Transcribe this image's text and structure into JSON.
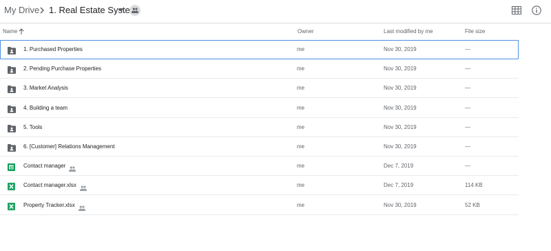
{
  "breadcrumb": {
    "root": "My Drive",
    "current": "1. Real Estate System"
  },
  "icons": {
    "breadcrumb_separator": "chevron-right-icon",
    "folder_dropdown": "caret-down-icon",
    "shared_folder": "people-icon",
    "grid_view": "grid-view-icon",
    "details": "info-icon",
    "sort": "arrow-up-icon"
  },
  "columns": {
    "name": "Name",
    "owner": "Owner",
    "last_modified": "Last modified by me",
    "file_size": "File size"
  },
  "colors": {
    "folder": "#5f6368",
    "sheets": "#0f9d58",
    "excel": "#21a366",
    "selection": "#4c8fe0"
  },
  "files": [
    {
      "name": "1. Purchased Properties",
      "type": "shared-folder",
      "shared": false,
      "owner": "me",
      "modified": "Nov 30, 2019",
      "size": "—",
      "selected": true
    },
    {
      "name": "2. Pending Purchase Properties",
      "type": "shared-folder",
      "shared": false,
      "owner": "me",
      "modified": "Nov 30, 2019",
      "size": "—",
      "selected": false
    },
    {
      "name": "3. Market Analysis",
      "type": "shared-folder",
      "shared": false,
      "owner": "me",
      "modified": "Nov 30, 2019",
      "size": "—",
      "selected": false
    },
    {
      "name": "4. Building a team",
      "type": "shared-folder",
      "shared": false,
      "owner": "me",
      "modified": "Nov 30, 2019",
      "size": "—",
      "selected": false
    },
    {
      "name": "5. Tools",
      "type": "shared-folder",
      "shared": false,
      "owner": "me",
      "modified": "Nov 30, 2019",
      "size": "—",
      "selected": false
    },
    {
      "name": "6. [Customer] Relations Management",
      "type": "shared-folder",
      "shared": false,
      "owner": "me",
      "modified": "Nov 30, 2019",
      "size": "—",
      "selected": false
    },
    {
      "name": "Contact manager",
      "type": "google-sheet",
      "shared": true,
      "owner": "me",
      "modified": "Dec 7, 2019",
      "size": "—",
      "selected": false
    },
    {
      "name": "Contact manager.xlsx",
      "type": "excel",
      "shared": true,
      "owner": "me",
      "modified": "Dec 7, 2019",
      "size": "114 KB",
      "selected": false
    },
    {
      "name": "Property Tracker.xlsx",
      "type": "excel",
      "shared": true,
      "owner": "me",
      "modified": "Nov 30, 2019",
      "size": "52 KB",
      "selected": false
    }
  ]
}
